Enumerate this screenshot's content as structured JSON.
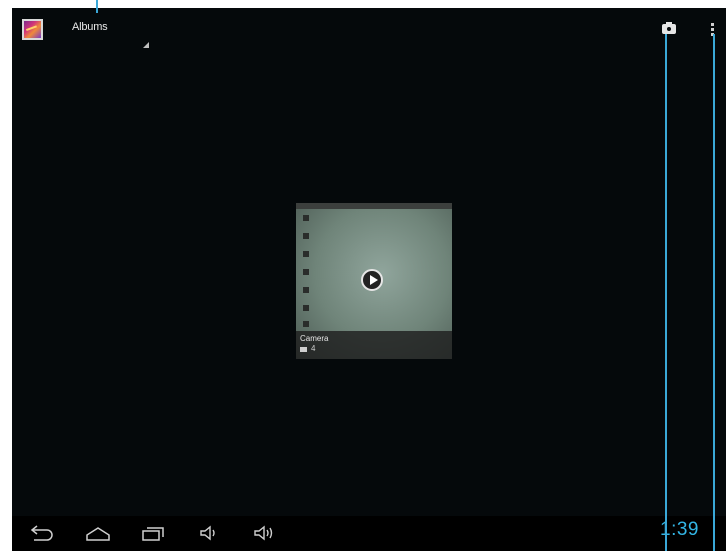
{
  "action_bar": {
    "album_selector_label": "Albums"
  },
  "album": {
    "name": "Camera",
    "count": "4"
  },
  "system_bar": {
    "clock": "1:39"
  },
  "icons": {
    "app": "gallery-icon",
    "dropdown": "dropdown-indicator-icon",
    "camera": "camera-icon",
    "overflow": "overflow-menu-icon",
    "play": "play-icon",
    "back": "back-icon",
    "home": "home-icon",
    "recents": "recent-apps-icon",
    "volume_down": "volume-down-icon",
    "volume_up": "volume-up-icon"
  },
  "colors": {
    "screen_background": "#05090b",
    "clock": "#33b5e5",
    "callout": "#3aa8d8"
  }
}
